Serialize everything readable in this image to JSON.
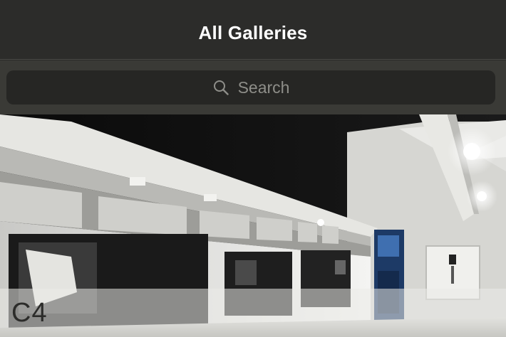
{
  "header": {
    "title": "All Galleries"
  },
  "search": {
    "placeholder": "Search",
    "icon": "search-icon"
  },
  "galleries": [
    {
      "name": "C4"
    }
  ],
  "colors": {
    "nav_background": "#2c2c2a",
    "search_area": "#3a3a36",
    "search_field": "#262624",
    "title_text": "#ffffff",
    "placeholder_text": "#8e8e89"
  }
}
